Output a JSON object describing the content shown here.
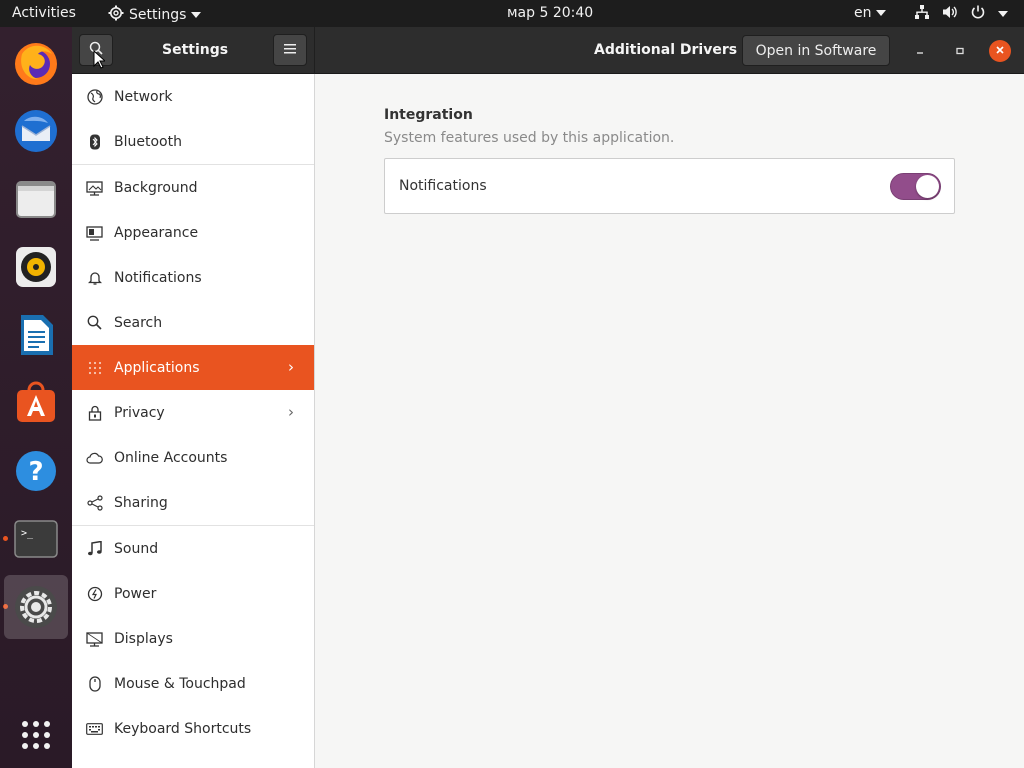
{
  "topbar": {
    "activities": "Activities",
    "app_menu": "Settings",
    "clock": "мар 5  20:40",
    "lang": "en"
  },
  "header": {
    "sidebar_title": "Settings",
    "panel_title": "Additional Drivers",
    "open_in_software": "Open in Software"
  },
  "sidebar": {
    "items": [
      {
        "label": "Network",
        "icon": "network-icon"
      },
      {
        "label": "Bluetooth",
        "icon": "bluetooth-icon"
      },
      {
        "label": "Background",
        "icon": "background-icon"
      },
      {
        "label": "Appearance",
        "icon": "appearance-icon"
      },
      {
        "label": "Notifications",
        "icon": "bell-icon"
      },
      {
        "label": "Search",
        "icon": "search-icon"
      },
      {
        "label": "Applications",
        "icon": "apps-grid-icon",
        "selected": true
      },
      {
        "label": "Privacy",
        "icon": "lock-icon"
      },
      {
        "label": "Online Accounts",
        "icon": "cloud-icon"
      },
      {
        "label": "Sharing",
        "icon": "share-icon"
      },
      {
        "label": "Sound",
        "icon": "music-note-icon"
      },
      {
        "label": "Power",
        "icon": "power-icon"
      },
      {
        "label": "Displays",
        "icon": "display-icon"
      },
      {
        "label": "Mouse & Touchpad",
        "icon": "mouse-icon"
      },
      {
        "label": "Keyboard Shortcuts",
        "icon": "keyboard-icon"
      }
    ]
  },
  "content": {
    "section_title": "Integration",
    "section_subtitle": "System features used by this application.",
    "notifications_label": "Notifications",
    "notifications_enabled": true
  },
  "colors": {
    "accent": "#e95420",
    "toggle_on": "#924d8b"
  }
}
